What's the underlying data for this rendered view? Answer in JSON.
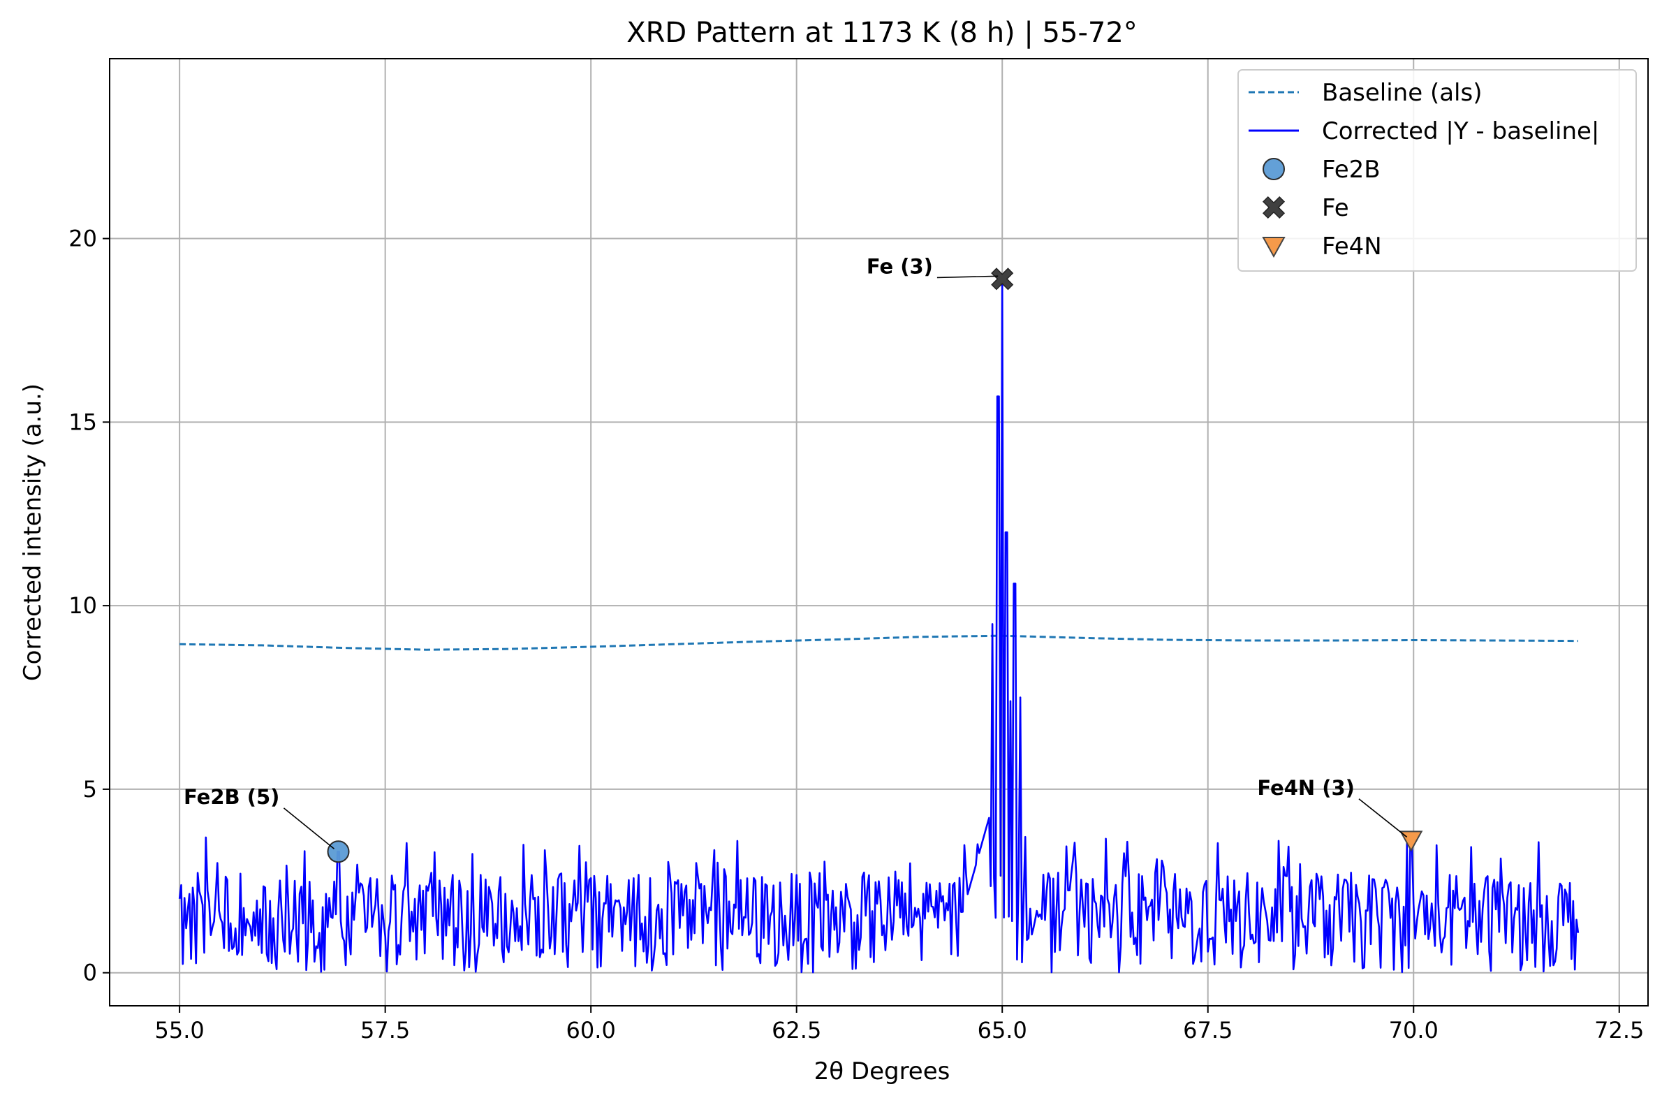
{
  "chart_data": {
    "type": "line",
    "title": "XRD Pattern at 1173 K (8 h) | 55-72°",
    "xlabel": "2θ Degrees",
    "ylabel": "Corrected intensity (a.u.)",
    "xlim": [
      54.15,
      72.85
    ],
    "ylim": [
      -0.9,
      24.9
    ],
    "xticks": [
      55.0,
      57.5,
      60.0,
      62.5,
      65.0,
      67.5,
      70.0,
      72.5
    ],
    "xtick_labels": [
      "55.0",
      "57.5",
      "60.0",
      "62.5",
      "65.0",
      "67.5",
      "70.0",
      "72.5"
    ],
    "yticks": [
      0,
      5,
      10,
      15,
      20
    ],
    "ytick_labels": [
      "0",
      "5",
      "10",
      "15",
      "20"
    ],
    "grid": true,
    "legend_position": "top-right",
    "series": [
      {
        "name": "Baseline (als)",
        "style": "dashed",
        "color": "#1f77b4",
        "x": [
          55.0,
          56.0,
          57.0,
          58.0,
          59.0,
          60.0,
          61.0,
          62.0,
          63.0,
          64.0,
          65.0,
          66.0,
          67.0,
          68.0,
          69.0,
          70.0,
          71.0,
          72.0
        ],
        "y": [
          8.95,
          8.92,
          8.85,
          8.8,
          8.82,
          8.88,
          8.95,
          9.02,
          9.08,
          9.15,
          9.18,
          9.12,
          9.07,
          9.05,
          9.05,
          9.06,
          9.05,
          9.04
        ]
      },
      {
        "name": "Corrected |Y - baseline|",
        "style": "solid",
        "color": "#0000ff",
        "peaks": [
          {
            "x": 56.93,
            "y": 3.3
          },
          {
            "x": 64.7,
            "y": 3.5
          },
          {
            "x": 64.88,
            "y": 9.5
          },
          {
            "x": 64.95,
            "y": 15.7
          },
          {
            "x": 65.0,
            "y": 18.9
          },
          {
            "x": 65.05,
            "y": 12.0
          },
          {
            "x": 65.1,
            "y": 7.4
          },
          {
            "x": 65.15,
            "y": 10.6
          },
          {
            "x": 65.22,
            "y": 7.5
          },
          {
            "x": 65.28,
            "y": 3.7
          },
          {
            "x": 69.97,
            "y": 3.5
          }
        ],
        "noise_range": [
          0,
          3.8
        ]
      }
    ],
    "markers": [
      {
        "name": "Fe2B",
        "symbol": "circle",
        "color": "#5b9bd5",
        "x": 56.93,
        "y": 3.3
      },
      {
        "name": "Fe",
        "symbol": "x",
        "color": "#404040",
        "x": 65.0,
        "y": 18.9
      },
      {
        "name": "Fe4N",
        "symbol": "triangle-down",
        "color": "#f59a4a",
        "x": 69.97,
        "y": 3.62
      }
    ],
    "annotations": [
      {
        "text": "Fe2B (5)",
        "target_x": 56.93,
        "target_y": 3.3,
        "text_x": 55.05,
        "text_y": 4.6,
        "anchor": "start"
      },
      {
        "text": "Fe (3)",
        "target_x": 65.0,
        "target_y": 18.9,
        "text_x": 63.35,
        "text_y": 19.05,
        "anchor": "start"
      },
      {
        "text": "Fe4N (3)",
        "target_x": 69.97,
        "target_y": 3.62,
        "text_x": 68.1,
        "text_y": 4.85,
        "anchor": "start"
      }
    ]
  }
}
